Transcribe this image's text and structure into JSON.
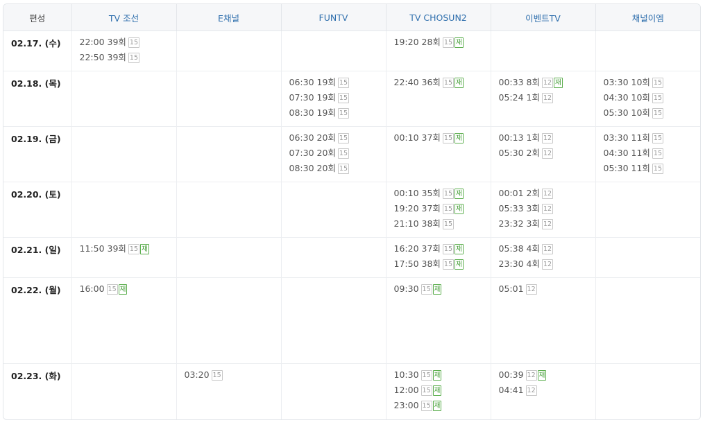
{
  "header": {
    "first": "편성",
    "channels": [
      "TV 조선",
      "E채널",
      "FUNTV",
      "TV CHOSUN2",
      "이벤트TV",
      "채널이엠"
    ]
  },
  "rows": [
    {
      "date": "02.17. (수)",
      "cells": [
        [
          {
            "t": "22:00 39회",
            "age": "15"
          },
          {
            "t": "22:50 39회",
            "age": "15"
          }
        ],
        [],
        [],
        [
          {
            "t": "19:20 28회",
            "age": "15",
            "re": "재"
          }
        ],
        [],
        []
      ]
    },
    {
      "date": "02.18. (목)",
      "cells": [
        [],
        [],
        [
          {
            "t": "06:30 19회",
            "age": "15"
          },
          {
            "t": "07:30 19회",
            "age": "15"
          },
          {
            "t": "08:30 19회",
            "age": "15"
          }
        ],
        [
          {
            "t": "22:40 36회",
            "age": "15",
            "re": "재"
          }
        ],
        [
          {
            "t": "00:33 8회",
            "age": "12",
            "re": "재"
          },
          {
            "t": "05:24 1회",
            "age": "12"
          }
        ],
        [
          {
            "t": "03:30 10회",
            "age": "15"
          },
          {
            "t": "04:30 10회",
            "age": "15"
          },
          {
            "t": "05:30 10회",
            "age": "15"
          }
        ]
      ]
    },
    {
      "date": "02.19. (금)",
      "cells": [
        [],
        [],
        [
          {
            "t": "06:30 20회",
            "age": "15"
          },
          {
            "t": "07:30 20회",
            "age": "15"
          },
          {
            "t": "08:30 20회",
            "age": "15"
          }
        ],
        [
          {
            "t": "00:10 37회",
            "age": "15",
            "re": "재"
          }
        ],
        [
          {
            "t": "00:13 1회",
            "age": "12"
          },
          {
            "t": "05:30 2회",
            "age": "12"
          }
        ],
        [
          {
            "t": "03:30 11회",
            "age": "15"
          },
          {
            "t": "04:30 11회",
            "age": "15"
          },
          {
            "t": "05:30 11회",
            "age": "15"
          }
        ]
      ]
    },
    {
      "date": "02.20. (토)",
      "cells": [
        [],
        [],
        [],
        [
          {
            "t": "00:10 35회",
            "age": "15",
            "re": "재"
          },
          {
            "t": "19:20 37회",
            "age": "15",
            "re": "재"
          },
          {
            "t": "21:10 38회",
            "age": "15"
          }
        ],
        [
          {
            "t": "00:01 2회",
            "age": "12"
          },
          {
            "t": "05:33 3회",
            "age": "12"
          },
          {
            "t": "23:32 3회",
            "age": "12"
          }
        ],
        []
      ]
    },
    {
      "date": "02.21. (일)",
      "cells": [
        [
          {
            "t": "11:50 39회",
            "age": "15",
            "re": "재"
          }
        ],
        [],
        [],
        [
          {
            "t": "16:20 37회",
            "age": "15",
            "re": "재"
          },
          {
            "t": "17:50 38회",
            "age": "15",
            "re": "재"
          }
        ],
        [
          {
            "t": "05:38 4회",
            "age": "12"
          },
          {
            "t": "23:30 4회",
            "age": "12"
          }
        ],
        []
      ]
    },
    {
      "date": "02.22. (월)",
      "cells": [
        [
          {
            "t": "16:00",
            "age": "15",
            "re": "재"
          }
        ],
        [],
        [],
        [
          {
            "t": "09:30",
            "age": "15",
            "re": "재"
          }
        ],
        [
          {
            "t": "05:01",
            "age": "12"
          }
        ],
        []
      ]
    },
    {
      "date": "02.23. (화)",
      "cells": [
        [],
        [
          {
            "t": "03:20",
            "age": "15"
          }
        ],
        [],
        [
          {
            "t": "10:30",
            "age": "15",
            "re": "재"
          },
          {
            "t": "12:00",
            "age": "15",
            "re": "재"
          },
          {
            "t": "23:00",
            "age": "15",
            "re": "재"
          }
        ],
        [
          {
            "t": "00:39",
            "age": "12",
            "re": "재"
          },
          {
            "t": "04:41",
            "age": "12"
          }
        ],
        []
      ]
    }
  ]
}
